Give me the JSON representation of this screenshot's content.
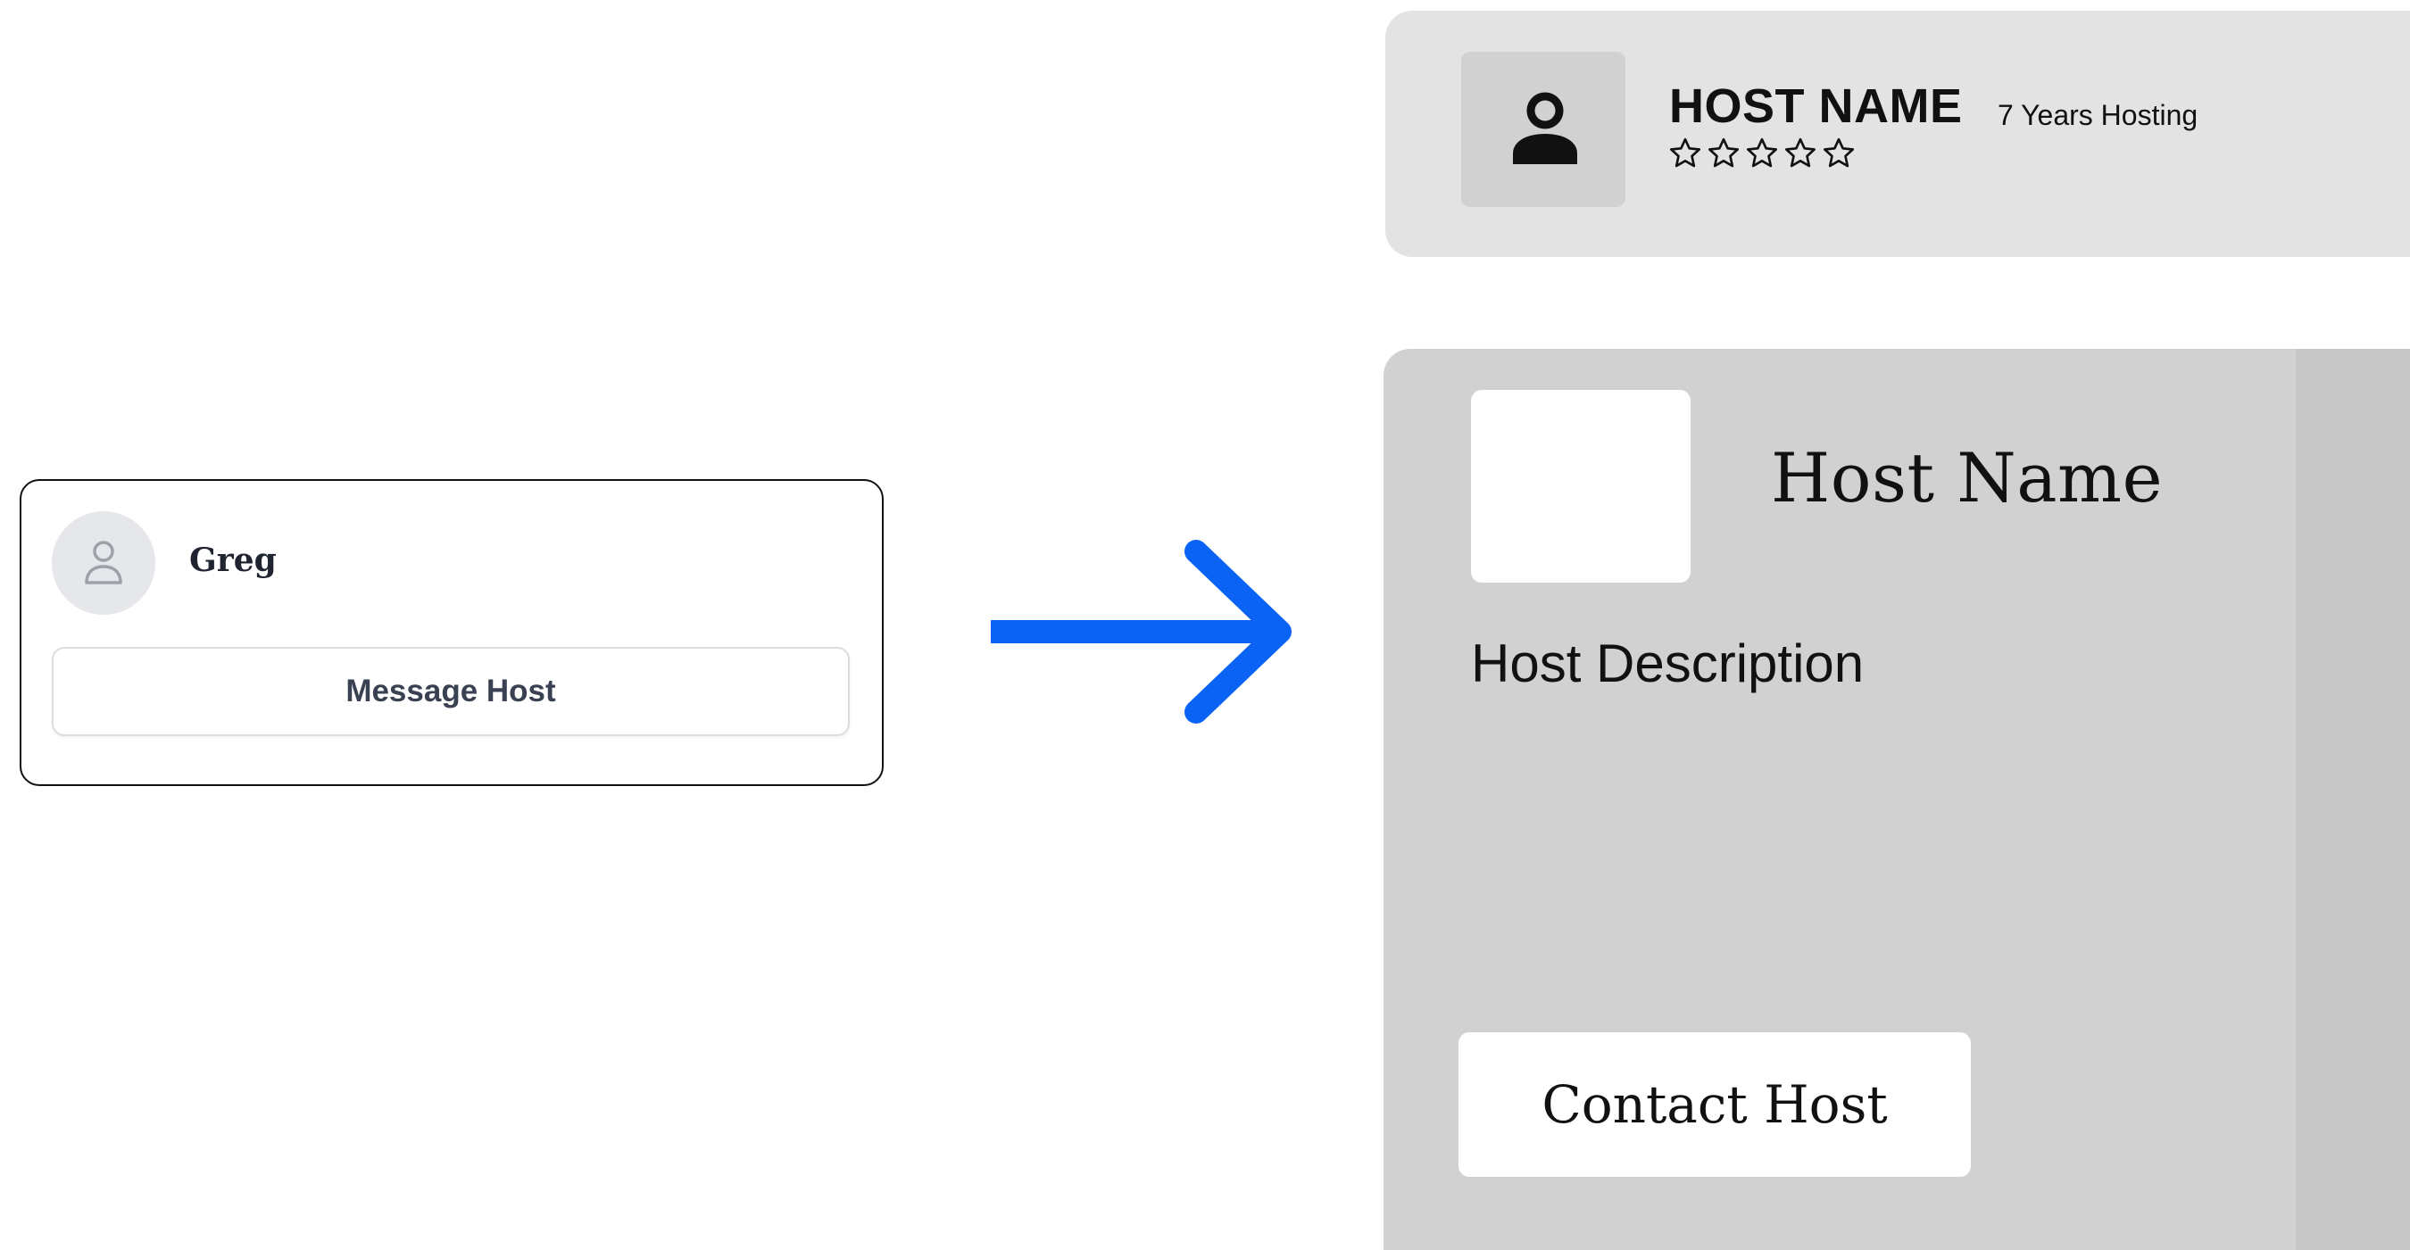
{
  "old_card": {
    "name": "Greg",
    "button_label": "Message Host",
    "avatar_icon": "user-outline-icon"
  },
  "arrow": {
    "icon": "arrow-right-icon",
    "color": "#0a63f5"
  },
  "new_header": {
    "name": "HOST NAME",
    "years": "7 Years Hosting",
    "stars_total": 5,
    "stars_filled": 0,
    "avatar_icon": "user-icon"
  },
  "new_detail": {
    "name": "Host Name",
    "description": "Host Description",
    "button_label": "Contact Host"
  }
}
